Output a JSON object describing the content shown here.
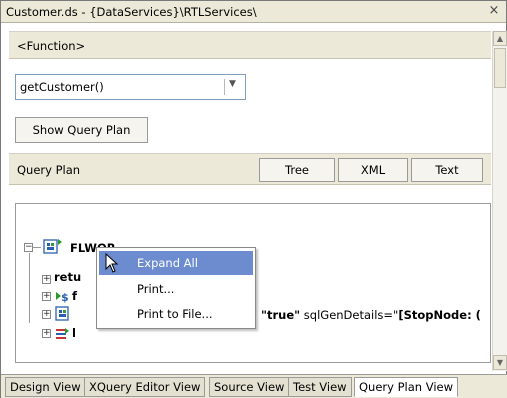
{
  "window": {
    "title": "Customer.ds - {DataServices}\\RTLServices\\",
    "close_glyph": "×"
  },
  "function_section": {
    "label": "<Function>",
    "selected_function": "getCustomer()",
    "show_plan_button": "Show Query Plan"
  },
  "query_plan": {
    "label": "Query Plan",
    "buttons": {
      "tree": "Tree",
      "xml": "XML",
      "text": "Text"
    }
  },
  "tree": {
    "root": {
      "label": "FLWOR",
      "expanded_glyph": "−"
    },
    "children": [
      {
        "label": "retu",
        "icon": "return-icon"
      },
      {
        "label": "f",
        "icon": "for-icon"
      },
      {
        "label": "\"true\" sqlGenDetails=\"[StopNode: (",
        "icon": "flwor-icon"
      },
      {
        "label": "l",
        "icon": "let-icon"
      }
    ],
    "collapsed_glyph": "+"
  },
  "context_menu": {
    "items": [
      "Expand All",
      "Print...",
      "Print to File..."
    ],
    "highlighted_index": 0
  },
  "tabs": [
    {
      "label": "Design View",
      "active": false
    },
    {
      "label": "XQuery Editor View",
      "active": false
    },
    {
      "label": "Source View",
      "active": false
    },
    {
      "label": "Test View",
      "active": false
    },
    {
      "label": "Query Plan View",
      "active": true
    }
  ],
  "colors": {
    "header_bg": "#ece9d8",
    "menu_highlight": "#6d8ccf"
  }
}
